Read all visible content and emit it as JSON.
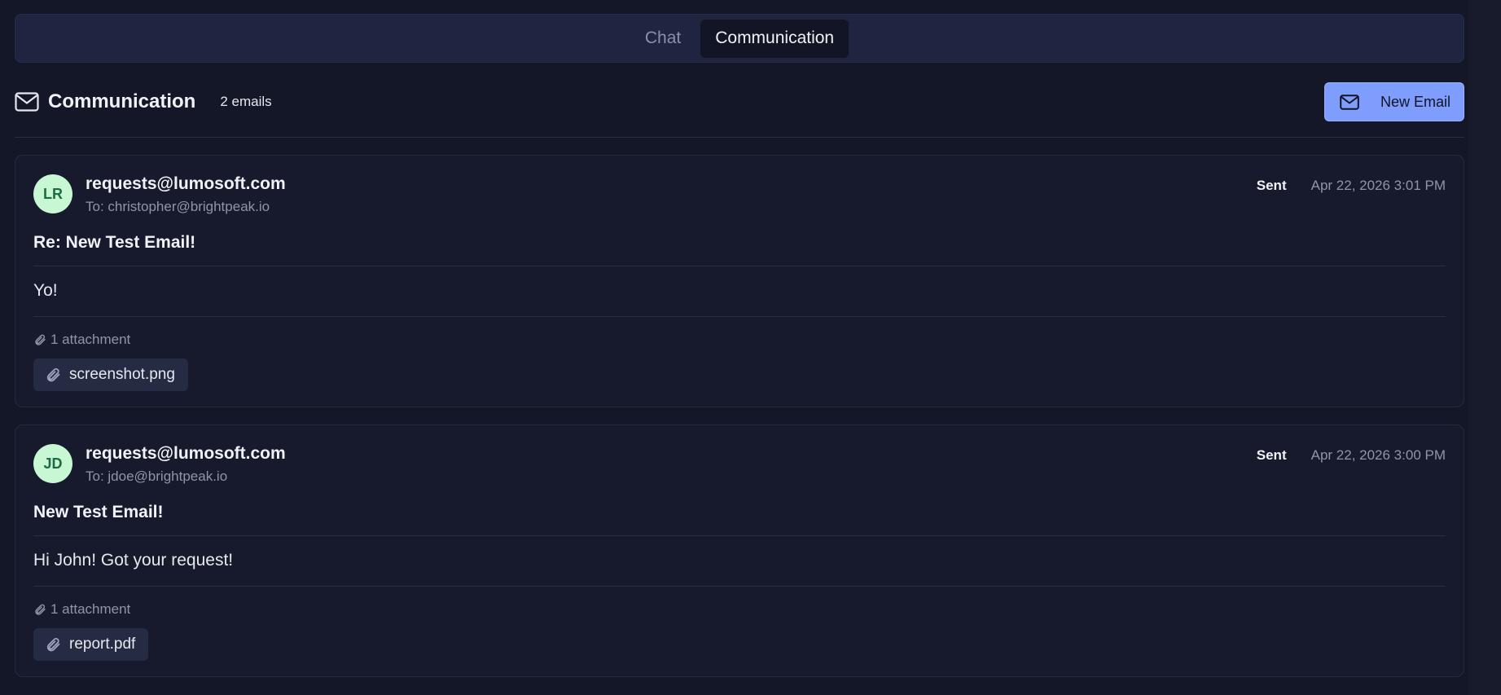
{
  "tabs": [
    {
      "label": "Chat",
      "active": false
    },
    {
      "label": "Communication",
      "active": true
    }
  ],
  "header": {
    "icon": "mail-icon",
    "title": "Communication",
    "count": "2 emails",
    "new_email_label": "New Email"
  },
  "colors": {
    "background": "#141728",
    "accent": "#7f9dfc",
    "avatar_bg": "#c8f7d4",
    "avatar_text": "#1d6b45"
  },
  "emails": [
    {
      "initials": "LR",
      "from": "requests@lumosoft.com",
      "to": "To: christopher@brightpeak.io",
      "status": "Sent",
      "date": "Apr 22, 2026 3:01 PM",
      "subject": "Re: New Test Email!",
      "body": "Yo!",
      "attachment_count": "1 attachment",
      "attachments": [
        "screenshot.png"
      ]
    },
    {
      "initials": "JD",
      "from": "requests@lumosoft.com",
      "to": "To: jdoe@brightpeak.io",
      "status": "Sent",
      "date": "Apr 22, 2026 3:00 PM",
      "subject": "New Test Email!",
      "body": "Hi John! Got your request!",
      "attachment_count": "1 attachment",
      "attachments": [
        "report.pdf"
      ]
    }
  ]
}
